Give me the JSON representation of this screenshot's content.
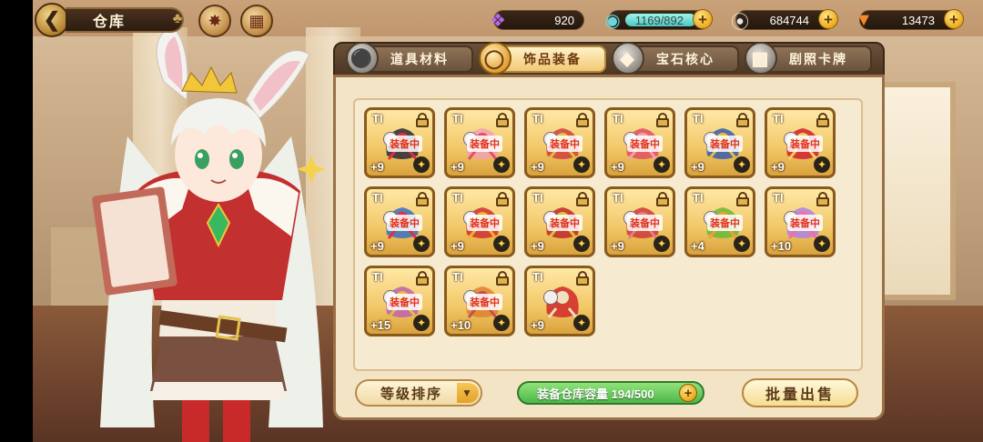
{
  "header": {
    "title": "仓库",
    "back_icon": "back-arrow-icon"
  },
  "resources": {
    "gems": "920",
    "stamina": "1169/892",
    "coins": "684744",
    "carrots": "13473"
  },
  "tabs": [
    {
      "label": "道具材料",
      "icon": "potion-icon",
      "active": false
    },
    {
      "label": "饰品装备",
      "icon": "ring-icon",
      "active": true
    },
    {
      "label": "宝石核心",
      "icon": "gem-core-icon",
      "active": false
    },
    {
      "label": "剧照卡牌",
      "icon": "card-icon",
      "active": false
    }
  ],
  "items": [
    {
      "tier": "TI",
      "level": "+9",
      "equipped": "装备中",
      "color": "#2a2a3a",
      "accent": "#e03040"
    },
    {
      "tier": "TI",
      "level": "+9",
      "equipped": "装备中",
      "color": "#f2a0b0",
      "accent": "#e05060"
    },
    {
      "tier": "TI",
      "level": "+9",
      "equipped": "装备中",
      "color": "#d04040",
      "accent": "#e0c040"
    },
    {
      "tier": "TI",
      "level": "+9",
      "equipped": "装备中",
      "color": "#e05060",
      "accent": "#f2a0b0"
    },
    {
      "tier": "TI",
      "level": "+9",
      "equipped": "装备中",
      "color": "#3a5ab0",
      "accent": "#e0c040"
    },
    {
      "tier": "TI",
      "level": "+9",
      "equipped": "装备中",
      "color": "#d02030",
      "accent": "#f0d060"
    },
    {
      "tier": "TI",
      "level": "+9",
      "equipped": "装备中",
      "color": "#3a70c0",
      "accent": "#e03040"
    },
    {
      "tier": "TI",
      "level": "+9",
      "equipped": "装备中",
      "color": "#d03030",
      "accent": "#f0b030"
    },
    {
      "tier": "TI",
      "level": "+9",
      "equipped": "装备中",
      "color": "#c02828",
      "accent": "#e0c040"
    },
    {
      "tier": "TI",
      "level": "+9",
      "equipped": "装备中",
      "color": "#d03838",
      "accent": "#e08080"
    },
    {
      "tier": "TI",
      "level": "+4",
      "equipped": "装备中",
      "color": "#6ab83a",
      "accent": "#f0a030"
    },
    {
      "tier": "TI",
      "level": "+10",
      "equipped": "装备中",
      "color": "#b080e0",
      "accent": "#f070a0"
    },
    {
      "tier": "TI",
      "level": "+15",
      "equipped": "装备中",
      "color": "#c060b0",
      "accent": "#e0c040"
    },
    {
      "tier": "TI",
      "level": "+10",
      "equipped": "装备中",
      "color": "#e08030",
      "accent": "#c05050"
    },
    {
      "tier": "TI",
      "level": "+9",
      "equipped": "",
      "color": "#d02828",
      "accent": "#f0e0c0"
    }
  ],
  "footer": {
    "sort_label": "等级排序",
    "capacity_label": "装备仓库容量 194/500",
    "sell_label": "批量出售"
  }
}
